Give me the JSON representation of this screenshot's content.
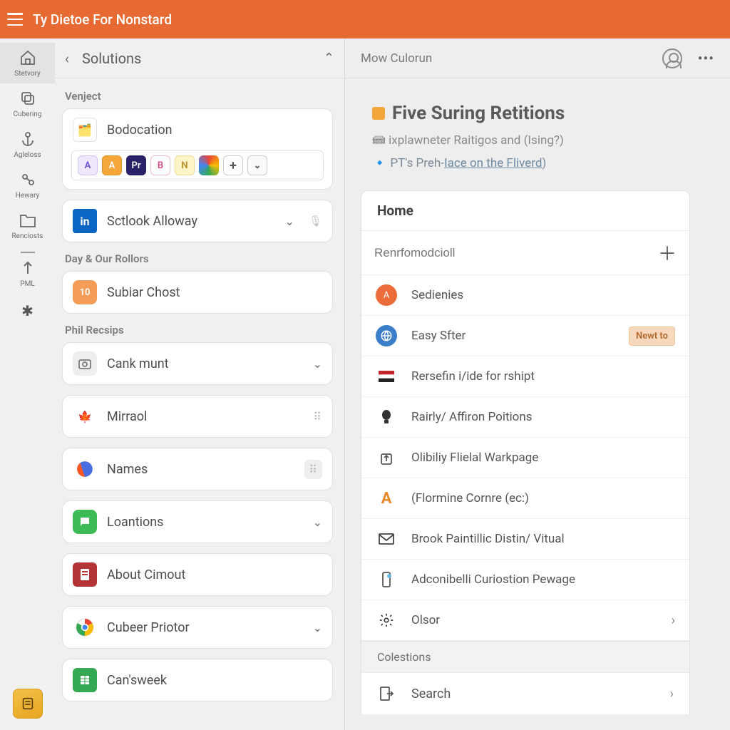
{
  "top": {
    "title": "Ty Dietoe For Nonstard"
  },
  "rail": {
    "items": [
      {
        "label": "Stetvory"
      },
      {
        "label": "Cubering"
      },
      {
        "label": "Agleloss"
      },
      {
        "label": "Hewary"
      },
      {
        "label": "Renciosts"
      },
      {
        "label": "PML"
      }
    ]
  },
  "solutions": {
    "back_title": "Solutions",
    "sections": {
      "venject": {
        "label": "Venject",
        "bodocation": "Bodocation",
        "chips": [
          "A",
          "A",
          "Pr",
          "B",
          "N"
        ]
      },
      "sctlook": {
        "title": "Sctlook Alloway"
      },
      "day": {
        "label": "Day & Our Rollors",
        "subiar": {
          "badge": "10",
          "title": "Subiar Chost"
        }
      },
      "phil": {
        "label": "Phil Recsips",
        "items": [
          {
            "title": "Cank munt"
          },
          {
            "title": "Mirraol"
          },
          {
            "title": "Names"
          }
        ]
      },
      "rest": [
        {
          "title": "Loantions"
        },
        {
          "title": "About Cimout"
        },
        {
          "title": "Cubeer Priotor"
        },
        {
          "title": "Can'sweek"
        }
      ]
    }
  },
  "right": {
    "header": "Mow Culorun",
    "hero": {
      "title": "Five Suring Retitions",
      "sub": "ixplawneter Raitigos and (Ising?)",
      "link_pre": "PT's Preh-",
      "link_text": "Iace on the Fliverd",
      "link_post": ")"
    },
    "panel": {
      "head": "Home",
      "search_placeholder": "Renrfomodcioll",
      "items": [
        {
          "name": "sedienies",
          "text": "Sedienies"
        },
        {
          "name": "easy-sfter",
          "text": "Easy Sfter",
          "badge": "Newt to"
        },
        {
          "name": "resefin",
          "text": "Rersefin i/ide for rshipt"
        },
        {
          "name": "rairly",
          "text": "Rairly/ Affiron Poitions"
        },
        {
          "name": "olibility",
          "text": "Olibiliy Flielal Warkpage"
        },
        {
          "name": "flormine",
          "text": "(Flormine Cornre (ec:)"
        },
        {
          "name": "brook",
          "text": "Brook Paintillic Distin/ Vitual"
        },
        {
          "name": "adconibelli",
          "text": "Adconibelli Curiostion Pewage"
        },
        {
          "name": "olsor",
          "text": "Olsor",
          "chevron": true
        }
      ],
      "section2": "Colestions",
      "search_row": "Search"
    }
  },
  "colors": {
    "accent": "#e86a33"
  }
}
